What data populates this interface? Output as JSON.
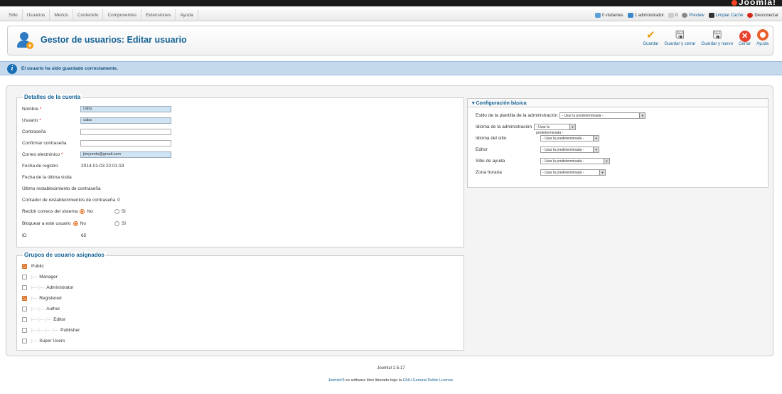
{
  "brand": "Joomla!",
  "menu": [
    "Sitio",
    "Usuarios",
    "Menús",
    "Contenido",
    "Componentes",
    "Extensiones",
    "Ayuda"
  ],
  "status": {
    "visitors": "0 visitantes",
    "admins": "1 administrador",
    "messages": "0",
    "preview": "Preview",
    "clear_cache": "Limpiar Caché",
    "logout": "Desconectar"
  },
  "page_title": "Gestor de usuarios: Editar usuario",
  "toolbar": {
    "save": "Guardar",
    "save_close": "Guardar y cerrar",
    "save_new": "Guardar y nuevo",
    "close": "Cerrar",
    "help": "Ayuda"
  },
  "message": "El usuario ha sido guardado correctamente.",
  "account": {
    "legend": "Detalles de la cuenta",
    "name_label": "Nombre",
    "name_value": "caba",
    "username_label": "Usuario",
    "username_value": "caba",
    "password_label": "Contraseña",
    "password_value": "",
    "confirm_label": "Confirmar contraseña",
    "confirm_value": "",
    "email_label": "Correo electrónico",
    "email_value": "jimyrento@gmail.com",
    "register_label": "Fecha de registro",
    "register_value": "2014-01-03 22:01:19",
    "last_visit_label": "Fecha de la última visita",
    "last_reset_label": "Último restablecimiento de contraseña",
    "reset_count_label": "Contador de restablecimientos de contraseña",
    "reset_count_value": "0",
    "system_email_label": "Recibir correos del sistema",
    "block_label": "Bloquear a este usuario",
    "no": "No",
    "yes": "Sí",
    "id_label": "ID",
    "id_value": "65"
  },
  "groups": {
    "legend": "Grupos de usuario asignados",
    "items": [
      {
        "label": "Public",
        "checked": true
      },
      {
        "label": "Manager",
        "checked": false
      },
      {
        "label": "Administrator",
        "checked": false
      },
      {
        "label": "Registered",
        "checked": true
      },
      {
        "label": "Author",
        "checked": false
      },
      {
        "label": "Editor",
        "checked": false
      },
      {
        "label": "Publisher",
        "checked": false
      },
      {
        "label": "Super Users",
        "checked": false
      }
    ]
  },
  "basic": {
    "title": "Configuración básica",
    "admin_template_label": "Estilo de la plantilla de la administración",
    "admin_lang_label": "Idioma de la administración",
    "site_lang_label": "Idioma del sitio",
    "editor_label": "Editor",
    "help_site_label": "Sitio de ayuda",
    "timezone_label": "Zona horaria",
    "default_option": "- Usar la predeterminada -"
  },
  "footer": {
    "version": "Joomla! 2.5.17",
    "joomla_link": "Joomla!®",
    "license_text": "es software libre liberado bajo la",
    "license_link": "GNU General Public License."
  }
}
